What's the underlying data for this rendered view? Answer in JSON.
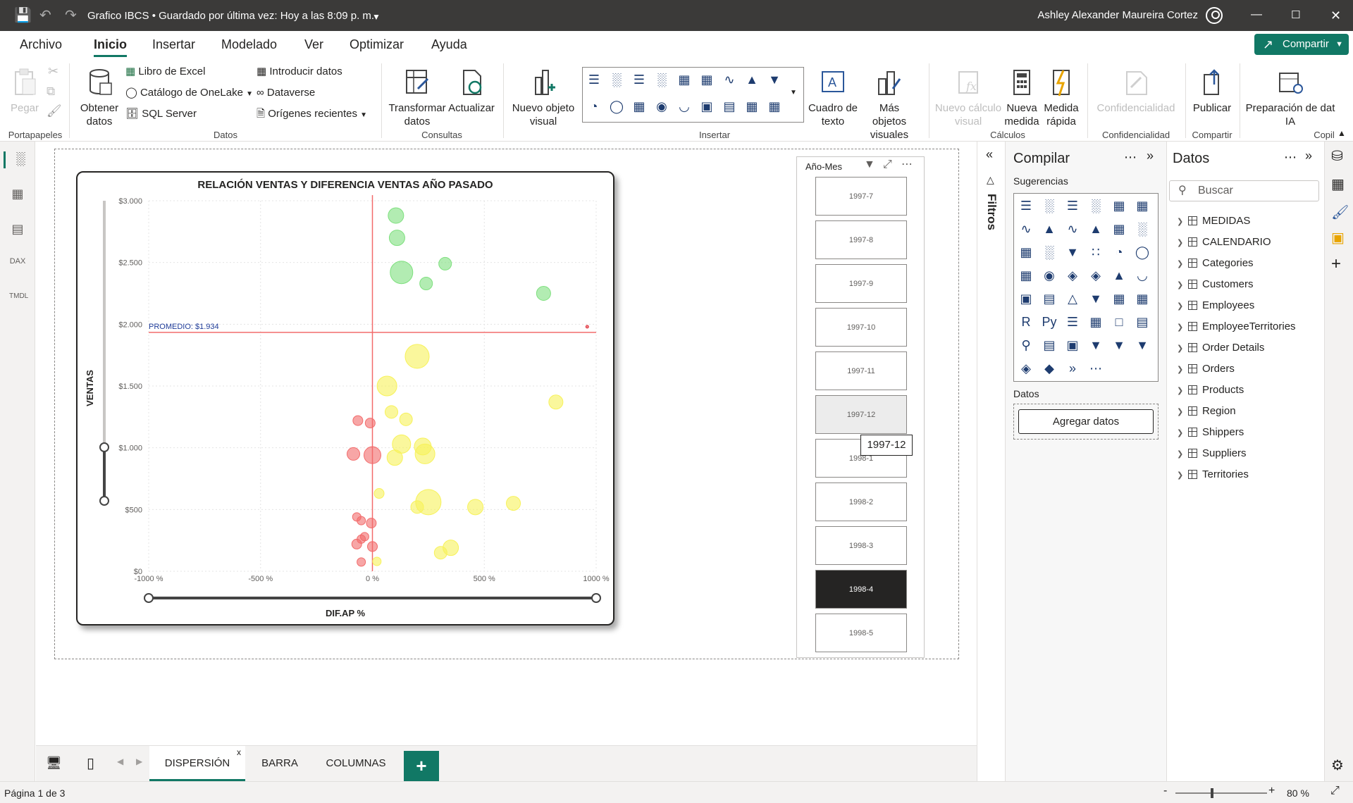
{
  "app": {
    "title": "Grafico IBCS • Guardado por última vez: Hoy a las 8:09 p. m.",
    "user": "Ashley Alexander Maureira Cortez",
    "share": "Compartir"
  },
  "menu": [
    "Archivo",
    "Inicio",
    "Insertar",
    "Modelado",
    "Ver",
    "Optimizar",
    "Ayuda"
  ],
  "ribbon": {
    "paste": "Pegar",
    "get_data": "Obtener datos",
    "excel": "Libro de Excel",
    "onelake": "Catálogo de OneLake",
    "sql": "SQL Server",
    "enter_data": "Introducir datos",
    "dataverse": "Dataverse",
    "recent": "Orígenes recientes",
    "transform": "Transformar datos",
    "refresh": "Actualizar",
    "new_visual": "Nuevo objeto visual",
    "textbox": "Cuadro de texto",
    "more_visuals": "Más objetos visuales",
    "new_calc": "Nuevo cálculo visual",
    "new_measure": "Nueva medida",
    "quick_measure": "Medida rápida",
    "sensitivity": "Confidencialidad",
    "publish": "Publicar",
    "prep_ai": "Preparación de dat IA",
    "groups": {
      "clipboard": "Portapapeles",
      "data": "Datos",
      "queries": "Consultas",
      "insert": "Insertar",
      "calc": "Cálculos",
      "sensitivity": "Confidencialidad",
      "share": "Compartir",
      "copilot": "Copil"
    }
  },
  "chart_data": {
    "type": "scatter",
    "title": "RELACIÓN VENTAS Y DIFERENCIA VENTAS AÑO PASADO",
    "xlabel": "DIF.AP %",
    "ylabel": "VENTAS",
    "xlim": [
      -1000,
      1000
    ],
    "ylim": [
      0,
      3000
    ],
    "x_ticks": [
      "-1000 %",
      "-500 %",
      "0 %",
      "500 %",
      "1000 %"
    ],
    "y_ticks": [
      "$0",
      "$500",
      "$1.000",
      "$1.500",
      "$2.000",
      "$2.500",
      "$3.000"
    ],
    "reference_line": {
      "label": "PROMEDIO: $1.934",
      "value": 1934
    },
    "points": [
      {
        "x": 105,
        "y": 2880,
        "size": 11,
        "color": "#7ee07e"
      },
      {
        "x": 110,
        "y": 2700,
        "size": 11,
        "color": "#7ee07e"
      },
      {
        "x": 130,
        "y": 2420,
        "size": 16,
        "color": "#7ee07e"
      },
      {
        "x": 240,
        "y": 2330,
        "size": 9,
        "color": "#7ee07e"
      },
      {
        "x": 325,
        "y": 2490,
        "size": 9,
        "color": "#7ee07e"
      },
      {
        "x": 765,
        "y": 2250,
        "size": 10,
        "color": "#7ee07e"
      },
      {
        "x": 200,
        "y": 1740,
        "size": 17,
        "color": "#f7f25a"
      },
      {
        "x": 65,
        "y": 1500,
        "size": 14,
        "color": "#f7f25a"
      },
      {
        "x": 820,
        "y": 1370,
        "size": 10,
        "color": "#f7f25a"
      },
      {
        "x": 85,
        "y": 1290,
        "size": 9,
        "color": "#f7f25a"
      },
      {
        "x": 150,
        "y": 1230,
        "size": 9,
        "color": "#f7f25a"
      },
      {
        "x": 130,
        "y": 1030,
        "size": 13,
        "color": "#f7f25a"
      },
      {
        "x": 225,
        "y": 1010,
        "size": 12,
        "color": "#f7f25a"
      },
      {
        "x": 235,
        "y": 950,
        "size": 14,
        "color": "#f7f25a"
      },
      {
        "x": 100,
        "y": 920,
        "size": 11,
        "color": "#f7f25a"
      },
      {
        "x": 30,
        "y": 630,
        "size": 7,
        "color": "#f7f25a"
      },
      {
        "x": 250,
        "y": 560,
        "size": 18,
        "color": "#f7f25a"
      },
      {
        "x": 200,
        "y": 520,
        "size": 9,
        "color": "#f7f25a"
      },
      {
        "x": 460,
        "y": 520,
        "size": 11,
        "color": "#f7f25a"
      },
      {
        "x": 630,
        "y": 550,
        "size": 10,
        "color": "#f7f25a"
      },
      {
        "x": 350,
        "y": 190,
        "size": 11,
        "color": "#f7f25a"
      },
      {
        "x": 305,
        "y": 150,
        "size": 9,
        "color": "#f7f25a"
      },
      {
        "x": 20,
        "y": 80,
        "size": 6,
        "color": "#f7f25a"
      },
      {
        "x": -65,
        "y": 1220,
        "size": 7,
        "color": "#f26b6b"
      },
      {
        "x": -10,
        "y": 1200,
        "size": 7,
        "color": "#f26b6b"
      },
      {
        "x": -85,
        "y": 950,
        "size": 9,
        "color": "#f26b6b"
      },
      {
        "x": 0,
        "y": 940,
        "size": 12,
        "color": "#f26b6b"
      },
      {
        "x": -70,
        "y": 440,
        "size": 6,
        "color": "#f26b6b"
      },
      {
        "x": -50,
        "y": 410,
        "size": 6,
        "color": "#f26b6b"
      },
      {
        "x": -5,
        "y": 390,
        "size": 7,
        "color": "#f26b6b"
      },
      {
        "x": -35,
        "y": 280,
        "size": 6,
        "color": "#f26b6b"
      },
      {
        "x": -70,
        "y": 220,
        "size": 7,
        "color": "#f26b6b"
      },
      {
        "x": -50,
        "y": 260,
        "size": 6,
        "color": "#f26b6b"
      },
      {
        "x": 0,
        "y": 200,
        "size": 7,
        "color": "#f26b6b"
      },
      {
        "x": -50,
        "y": 75,
        "size": 6,
        "color": "#f26b6b"
      },
      {
        "x": 960,
        "y": 1980,
        "size": 2,
        "color": "#e0303a"
      }
    ]
  },
  "slicer": {
    "title": "Año-Mes",
    "items": [
      "1997-7",
      "1997-8",
      "1997-9",
      "1997-10",
      "1997-11",
      "1997-12",
      "1998-1",
      "1998-2",
      "1998-3",
      "1998-4",
      "1998-5"
    ],
    "selected": "1998-4",
    "tooltip": "1997-12"
  },
  "filters_label": "Filtros",
  "compile": {
    "title": "Compilar",
    "suggestions": "Sugerencias",
    "data_label": "Datos",
    "add_data": "Agregar datos"
  },
  "data_pane": {
    "title": "Datos",
    "search_placeholder": "Buscar",
    "tables": [
      "MEDIDAS",
      "CALENDARIO",
      "Categories",
      "Customers",
      "Employees",
      "EmployeeTerritories",
      "Order Details",
      "Orders",
      "Products",
      "Region",
      "Shippers",
      "Suppliers",
      "Territories"
    ]
  },
  "tabs": [
    "DISPERSIÓN",
    "BARRA",
    "COLUMNAS"
  ],
  "active_tab": "DISPERSIÓN",
  "status": {
    "page": "Página 1 de 3",
    "zoom": "80 %"
  }
}
